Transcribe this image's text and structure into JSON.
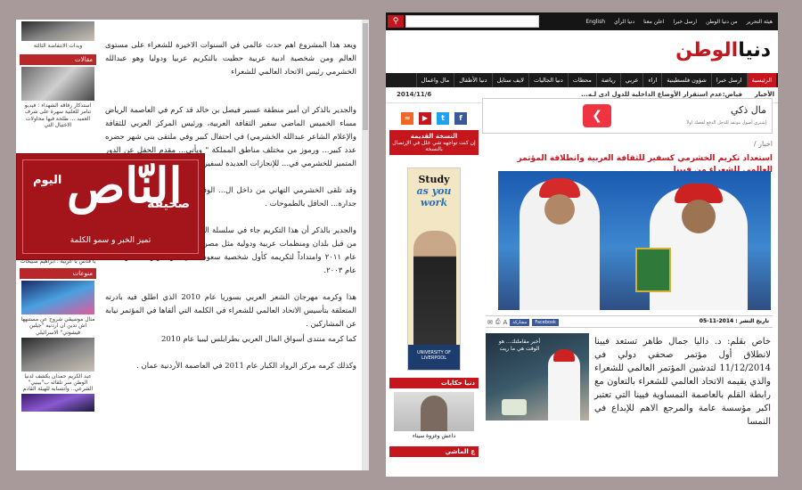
{
  "left_panel": {
    "sidebar": {
      "top_caption": "وبدات الانتفاضة الثالثة",
      "section_articles": "مقالات",
      "article1_caption": "استذكار رفاقه الشهداء : فيديو تنامر للعلنية سهرة على شرف العميد ... طلحة فيها محاولات الاختيال التي",
      "below_logo_caption": "يا قدس يا عربية : ابراهيم صبيحات",
      "section_misc": "منوعات",
      "misc1_caption": "مثال موسيقي شروح عن مستنهها اش تدين ان اردنيه \"جيلين فيشوني\" الاسرائيلي",
      "misc2_caption": "عبد الكريم حمدان يكشف لدنيا الوطن سر تلقائه ب\"بيبيي\" الشرعي.. وانتسابه للهيئة القادم"
    },
    "article": {
      "p1": "ويعد هذا المشروع اهم حدث عالمي في السنوات الاخيرة للشعراء على مستوى العالم ومن شخصية ادبية عربية حظيت بالتكريم عربيا ودوليا وهو عبدالله الخشرمي رئيس الاتحاد العالمي للشعراء",
      "p2": "والجدير بالذكر ان أمير منطقة عسير فيصل بن خالد قد كرم في العاصمة الرياض مساء الخميس الماضي سفير الثقافة العربية، ورئيس المركز العربي للثقافة والإعلام الشاعر عبدالله الخشرمي) في احتفال كبير وفي ملتقى بني شهر حضره عدد كبير... ورموز من مختلف مناطق المملكة \" ويأتي... مقدم الحفل عن الدور المتميز للخشرمي في... للإنجازات العديدة لسفير الثقافة العربية محليا",
      "p3": "وقد تلقى الخشرمي التهاني من داخل ال... الوفاء الذي استحقه الخشرمي عن جدارة... الحافل بالطموحات .",
      "p4": "والجدير بالذكر أن هذا التكريم جاء في سلسلة التكريمات السابقة التي حظي بها من قبل بلدان ومنظمات عربية ودولية مثل مصر عبر وزارة الثقافة واتحاد كتابها عام ٢٠١١ وامتداداً لتكريمه كأول شخصية سعودية في دار الأوبرا المصرية منذ عام ٢٠٠٣.",
      "p5": "هذا وكرمه مهرجان الشعر العربي بسوريا عام 2010 الذي اطلق فيه بادرته المتعلقة بتأسيس الاتحاد العالمي للشعراء في الكلمة التي ألقاها في المؤتمر نيابة عن المشاركين .",
      "p5b": "كما كرمه منتدى أسواق المال العربي بطرابلس ليبيا عام 2010",
      "p6": "وكذلك كرمه مركز الرواد الكبار عام 2011 في العاصمة الأردنية عمان ."
    },
    "logo": {
      "today": "اليوم",
      "name": "النّاص",
      "paper": "صحيفة",
      "slogan": "تميز الخبر و سمو الكلمة"
    }
  },
  "right_panel": {
    "topbar": {
      "search_placeholder": "",
      "links": [
        "هيئة التحرير",
        "من دنيا الوطن",
        "ارسل خبرا",
        "اعلن معنا",
        "دنيا الرأي",
        "English"
      ]
    },
    "site": {
      "logo_a": "دنيا",
      "logo_b": "الوطن",
      "tagline": ""
    },
    "nav": [
      "الرئيسية",
      "ارسل خبرا",
      "شؤون فلسطينية",
      "اراء",
      "عربي",
      "رياضة",
      "محطات",
      "دنيا الجاليات",
      "لايف ستايل",
      "دنيا الأطفال",
      "مال واعمال"
    ],
    "ticker": {
      "label": "الأخبار",
      "text": "فياض:عدم استقرار الأوضاع الداخلية للدول ادى لـه...",
      "date": "2014/11/6"
    },
    "sidebar": {
      "prev_title": "النسخة القديمة",
      "prev_sub": "إن كنت تواجهه شي خلل في الإرتصال بالنسخة",
      "study_line1": "Study",
      "study_line2": "as you",
      "study_line3": "work",
      "study_uni": "UNIVERSITY OF LIVERPOOL",
      "section_stories": "دنيا حكايات",
      "stories_caption": "داعش وغزوة سيناء",
      "section_next": "ع الماشي"
    },
    "ad": {
      "title": "مال ذكي",
      "sub": "إشتري أصول موثقة للدخل الدفع لقصك اولاً"
    },
    "breadcrumb": "اخبار /",
    "title": "استعداد تكريم الخشرمي كسفير للثقافة العربية وانطلاقة المؤتمر العالمي للشعراء من فيينا",
    "meta": {
      "date": "تاريخ النشر : 2014-11-05",
      "share": "مشاركة",
      "fb": "Facebook"
    },
    "ad2_text": "أخبر مقاملتك... هو الوقت هي ما ريت",
    "body": "خاص بقلم: د. داليا جمال طاهر تستعد فيينا لانطلاق أول مؤتمر صحفي دولي في 11/12/2014 لتدشين المؤتمر العالمي للشعراء والذي يقيمه الاتحاد العالمي للشعراء بالتعاون مع رابطة القلم بالعاصمة النمساوية فيينا التي تعتبر اكبر مؤسسة عامة والمرجع الاهم للإبداع في النمسا"
  }
}
